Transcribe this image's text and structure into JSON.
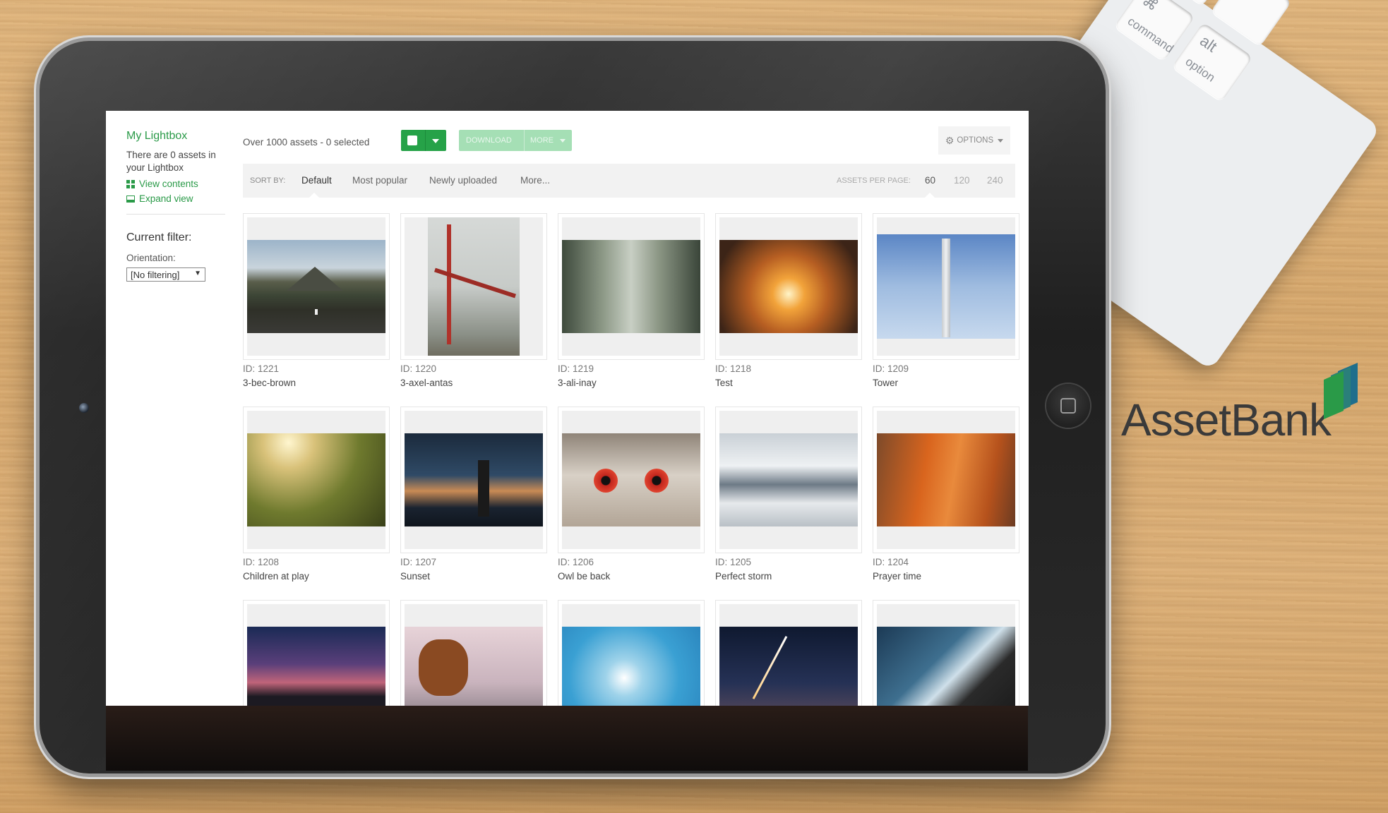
{
  "sidebar": {
    "lightbox_title": "My Lightbox",
    "lightbox_text": "There are 0 assets in your Lightbox",
    "view_contents": "View contents",
    "expand_view": "Expand view",
    "current_filter": "Current filter:",
    "orientation_label": "Orientation:",
    "orientation_value": "[No filtering]"
  },
  "toolbar": {
    "asset_count": "Over 1000 assets - 0 selected",
    "download": "DOWNLOAD",
    "more": "MORE",
    "options": "OPTIONS"
  },
  "sortbar": {
    "label": "SORT BY:",
    "options": [
      "Default",
      "Most popular",
      "Newly uploaded",
      "More..."
    ],
    "active_option": "Default",
    "per_page_label": "ASSETS PER PAGE:",
    "per_page_options": [
      "60",
      "120",
      "240"
    ],
    "per_page_active": "60"
  },
  "assets": [
    {
      "id": "ID: 1221",
      "name": "3-bec-brown"
    },
    {
      "id": "ID: 1220",
      "name": "3-axel-antas"
    },
    {
      "id": "ID: 1219",
      "name": "3-ali-inay"
    },
    {
      "id": "ID: 1218",
      "name": "Test"
    },
    {
      "id": "ID: 1209",
      "name": "Tower"
    },
    {
      "id": "ID: 1208",
      "name": "Children at play"
    },
    {
      "id": "ID: 1207",
      "name": "Sunset"
    },
    {
      "id": "ID: 1206",
      "name": "Owl be back"
    },
    {
      "id": "ID: 1205",
      "name": "Perfect storm"
    },
    {
      "id": "ID: 1204",
      "name": "Prayer time"
    }
  ],
  "brand": {
    "name": "AssetBank"
  },
  "keyboard": {
    "keys": [
      "command",
      "option",
      "alt"
    ]
  },
  "colors": {
    "accent": "#26a248",
    "download_disabled": "#a5dfb5",
    "logo_green": "#2a9a48",
    "logo_teal": "#1f6e8c"
  }
}
